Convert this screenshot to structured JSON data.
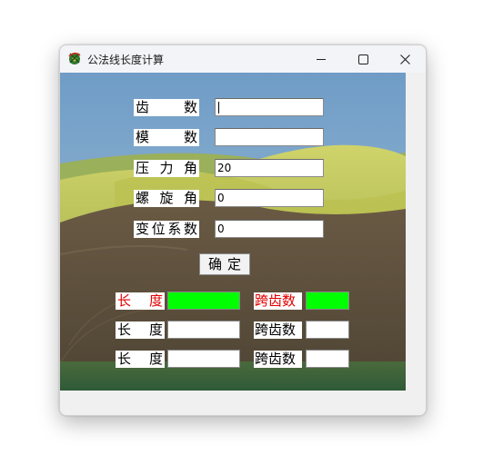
{
  "window": {
    "title": "公法线长度计算",
    "controls": {
      "minimize": "minimize",
      "maximize": "maximize",
      "close": "close"
    }
  },
  "form": {
    "teeth": {
      "label_chars": [
        "齿",
        "数"
      ],
      "value": ""
    },
    "module": {
      "label_chars": [
        "模",
        "数"
      ],
      "value": ""
    },
    "pressure_angle": {
      "label_chars": [
        "压",
        "力",
        "角"
      ],
      "value": "20"
    },
    "helix_angle": {
      "label_chars": [
        "螺",
        "旋",
        "角"
      ],
      "value": "0"
    },
    "shift_coefficient": {
      "label_chars": [
        "变",
        "位",
        "系",
        "数"
      ],
      "value": "0"
    },
    "confirm_chars": [
      "确",
      "定"
    ]
  },
  "results": [
    {
      "length_chars": [
        "长",
        "度"
      ],
      "span_label": "跨齿数",
      "highlight": true
    },
    {
      "length_chars": [
        "长",
        "度"
      ],
      "span_label": "跨齿数",
      "highlight": false
    },
    {
      "length_chars": [
        "长",
        "度"
      ],
      "span_label": "跨齿数",
      "highlight": false
    }
  ],
  "colors": {
    "result_highlight": "#00ff00",
    "highlight_text": "#e00000"
  }
}
